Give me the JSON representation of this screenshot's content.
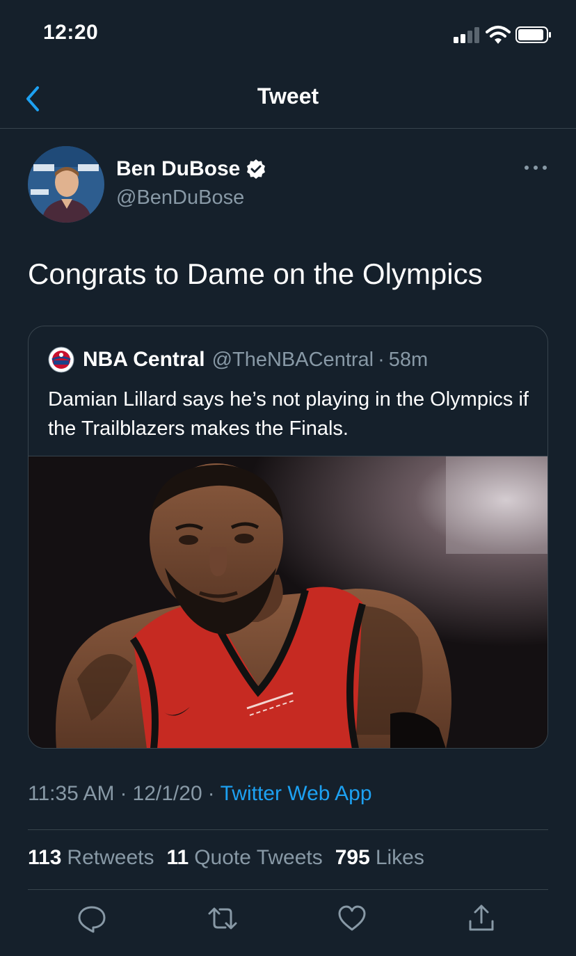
{
  "status_bar": {
    "time": "12:20"
  },
  "nav": {
    "title": "Tweet",
    "back_icon": "chevron-left-icon"
  },
  "tweet": {
    "author_name": "Ben DuBose",
    "author_handle": "@BenDuBose",
    "verified": true,
    "text": "Congrats to Dame on the Olympics",
    "time": "11:35 AM",
    "date": "12/1/20",
    "source": "Twitter Web App",
    "separator": "·"
  },
  "quote": {
    "author_name": "NBA Central",
    "author_handle": "@TheNBACentral",
    "separator": "·",
    "age": "58m",
    "text": "Damian Lillard says he’s not playing in the Olympics if the Trailblazers makes the Finals."
  },
  "stats": {
    "retweets_count": "113",
    "retweets_label": "Retweets",
    "quote_tweets_count": "11",
    "quote_tweets_label": "Quote Tweets",
    "likes_count": "795",
    "likes_label": "Likes"
  },
  "actions": [
    "reply-icon",
    "retweet-icon",
    "like-icon",
    "share-icon"
  ],
  "colors": {
    "background": "#15202b",
    "border": "#38444d",
    "secondary_text": "#8899a6",
    "link": "#1da1f2"
  }
}
